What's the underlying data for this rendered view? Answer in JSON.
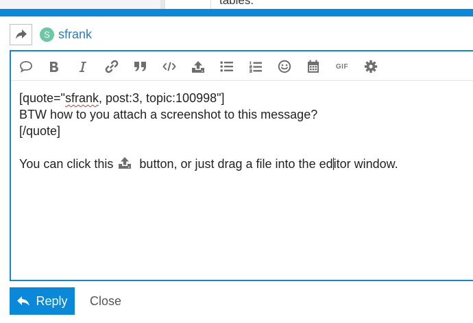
{
  "background_page": {
    "partial_text": "tables."
  },
  "reply_header": {
    "action_icon": "share-arrow-icon",
    "avatar_letter": "S",
    "username": "sfrank"
  },
  "toolbar": {
    "buttons": [
      "quote-bubble-icon",
      "bold-icon",
      "italic-icon",
      "link-icon",
      "blockquote-icon",
      "code-icon",
      "upload-icon",
      "bullet-list-icon",
      "numbered-list-icon",
      "emoji-icon",
      "calendar-icon",
      "gif",
      "gear-icon"
    ],
    "gif_label": "GIF"
  },
  "editor": {
    "line1_prefix": "[quote=\"",
    "line1_user": "sfrank",
    "line1_suffix": ", post:3, topic:100998\"]",
    "line2": "BTW how to you attach a screenshot to this message?",
    "line3": "[/quote]",
    "line5_before": "You can click this ",
    "line5_mid": " button, or just drag a file into the ed",
    "line5_after": "itor window."
  },
  "footer": {
    "reply_label": "Reply",
    "close_label": "Close"
  },
  "colors": {
    "accent": "#0a88d9",
    "username": "#2b7dbf",
    "avatar": "#6cc7a3"
  }
}
